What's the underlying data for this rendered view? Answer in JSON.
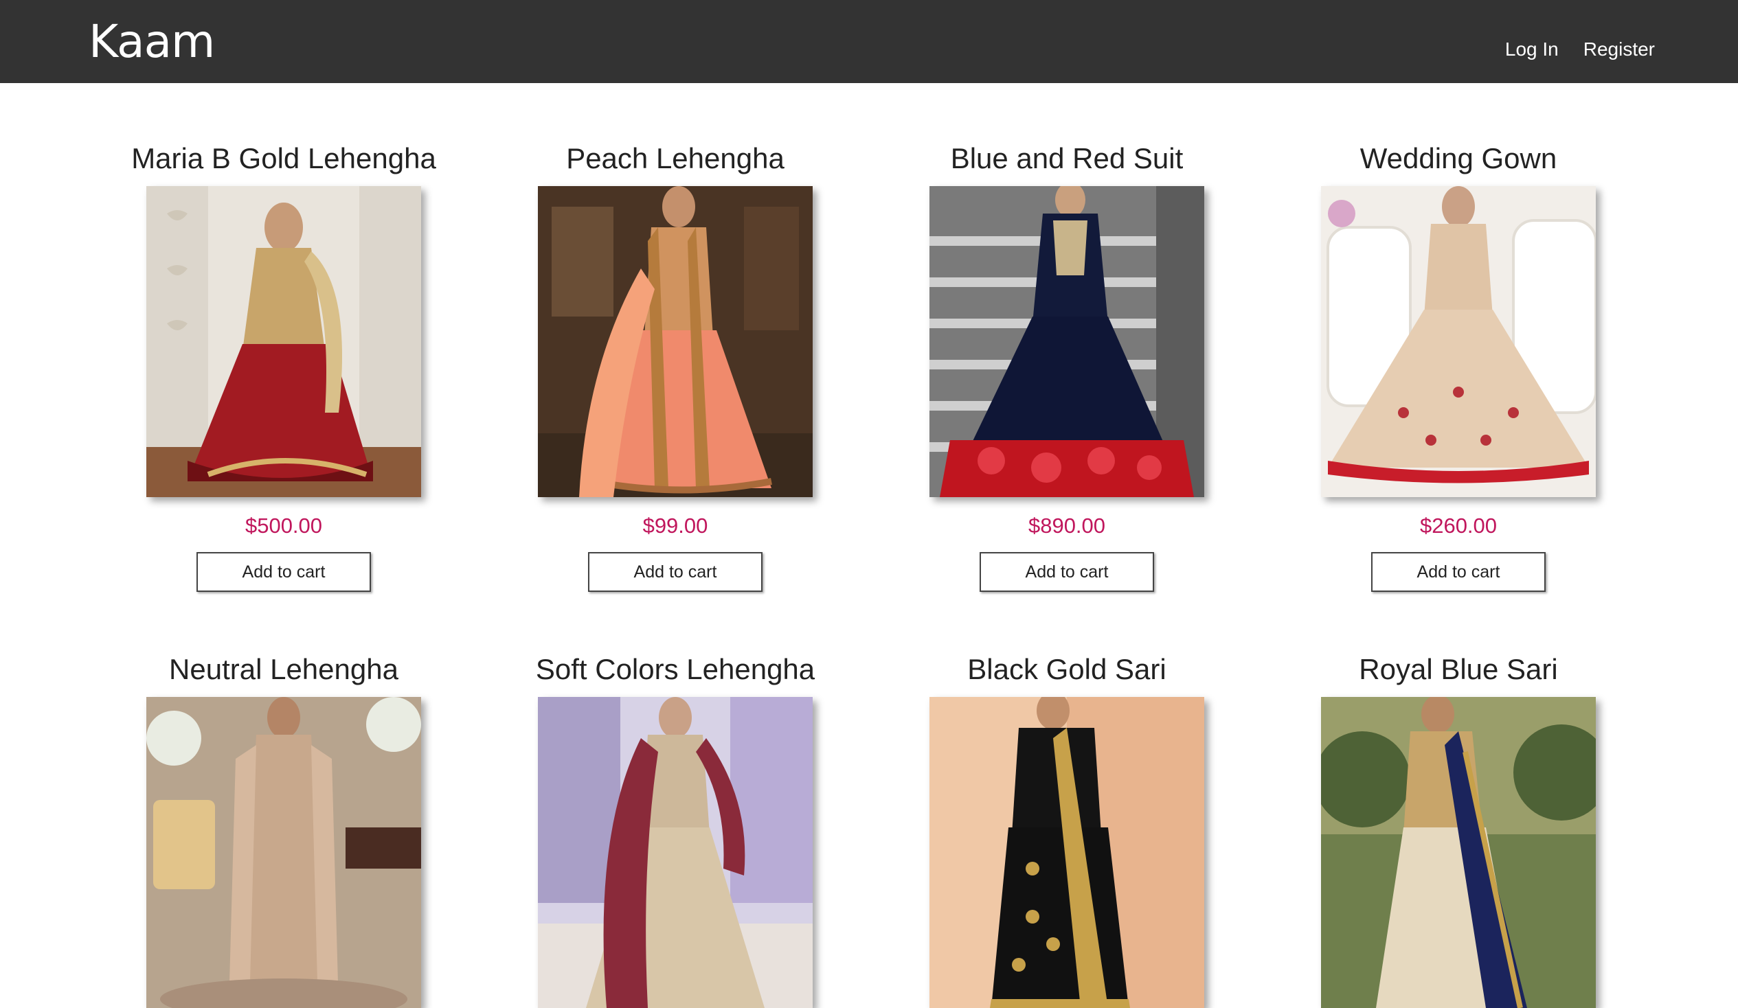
{
  "header": {
    "brand": "Kaam",
    "login_label": "Log In",
    "register_label": "Register"
  },
  "colors": {
    "navbar": "#333333",
    "price": "#c0165c",
    "background": "#ffffff"
  },
  "products": [
    {
      "name": "Maria B Gold Lehengha",
      "price": "$500.00",
      "button": "Add to cart",
      "image": "woman in gold and red bridal lehenga in white ornate room"
    },
    {
      "name": "Peach Lehengha",
      "price": "$99.00",
      "button": "Add to cart",
      "image": "woman in peach lehenga with gold jacket in dark wooden room"
    },
    {
      "name": "Blue and Red Suit",
      "price": "$890.00",
      "button": "Add to cart",
      "image": "woman in navy anarkali with red floral hem on stone staircase"
    },
    {
      "name": "Wedding Gown",
      "price": "$260.00",
      "button": "Add to cart",
      "image": "woman in beige embroidered gown with red hem beside white sofa"
    },
    {
      "name": "Neutral Lehengha",
      "price": "",
      "button": "",
      "image": "woman in neutral embroidered long gown in furnished room"
    },
    {
      "name": "Soft Colors Lehengha",
      "price": "",
      "button": "",
      "image": "woman in maroon dupatta and beige lehenga in bright hall"
    },
    {
      "name": "Black Gold Sari",
      "price": "",
      "button": "",
      "image": "woman in black and gold sari against peach wall"
    },
    {
      "name": "Royal Blue Sari",
      "price": "",
      "button": "",
      "image": "woman in royal blue and cream sari in garden"
    }
  ]
}
